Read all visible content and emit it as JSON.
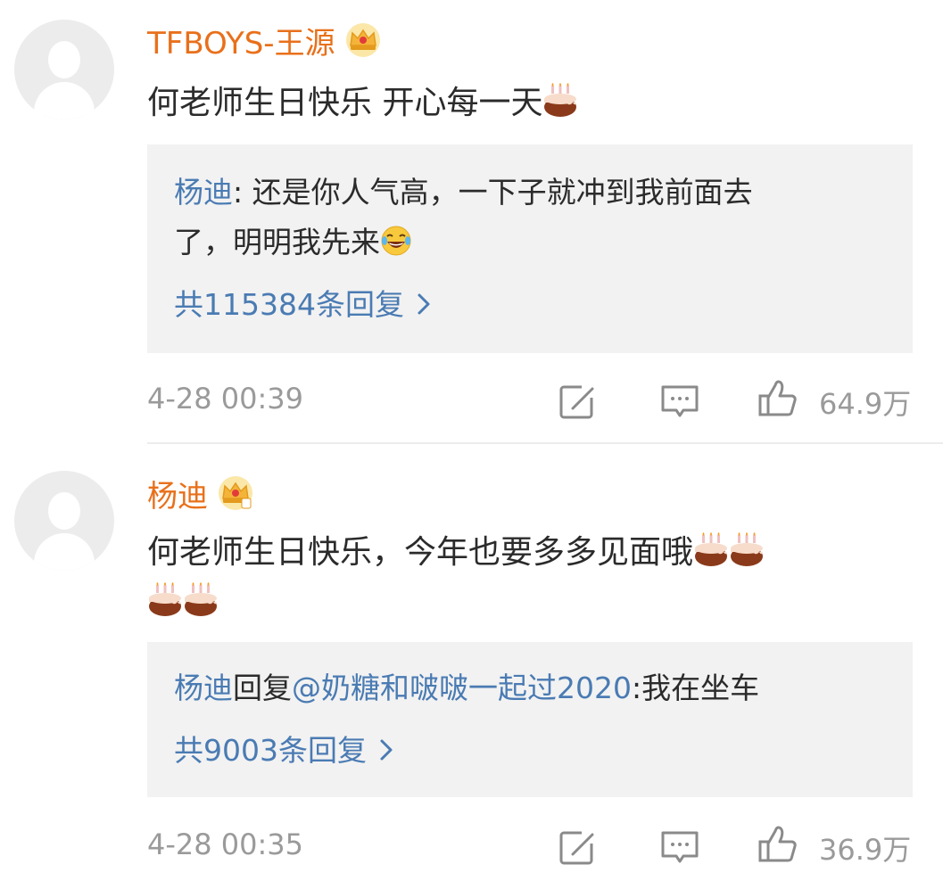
{
  "comments": [
    {
      "username": "TFBOYS-王源",
      "text_parts": [
        "何老师生日快乐  开心每一天"
      ],
      "reply": {
        "author": "杨迪",
        "separator": ": ",
        "text_line1": "还是你人气高，一下子就冲到我前面去",
        "text_line2": "了，明明我先来",
        "more_label": "共115384条回复"
      },
      "time": "4-28 00:39",
      "likes": "64.9万"
    },
    {
      "username": "杨迪",
      "text_parts": [
        "何老师生日快乐，今年也要多多见面哦"
      ],
      "reply": {
        "author": "杨迪",
        "reply_word": "回复",
        "mention": "@奶糖和啵啵一起过2020",
        "separator": ":",
        "text_line1": "我在坐车",
        "more_label": "共9003条回复"
      },
      "time": "4-28 00:35",
      "likes": "36.9万"
    }
  ],
  "icons": {
    "crown": "crown-badge-icon",
    "cake": "birthday-cake-emoji",
    "laugh": "laughing-tears-emoji",
    "repost": "repost-icon",
    "comment": "comment-icon",
    "like": "like-thumb-icon",
    "chevron": "chevron-right-icon"
  },
  "colors": {
    "username": "#e8701b",
    "link": "#4a7bb3",
    "meta": "#9a9a9a",
    "reply_bg": "#f2f2f2"
  }
}
